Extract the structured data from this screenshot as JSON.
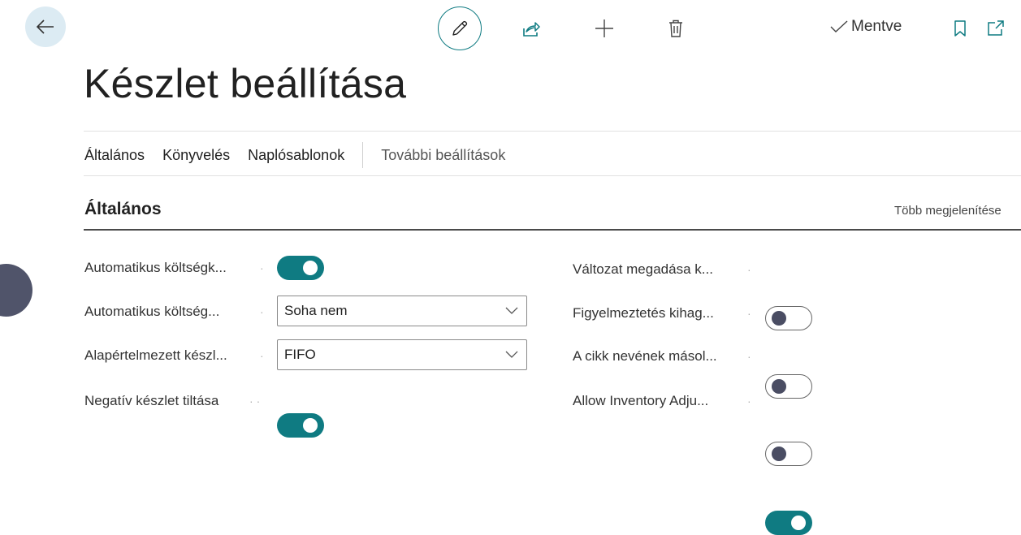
{
  "header": {
    "saved_label": "Mentve"
  },
  "page": {
    "title": "Készlet beállítása"
  },
  "tabs": [
    {
      "label": "Általános"
    },
    {
      "label": "Könyvelés"
    },
    {
      "label": "Naplósablonok"
    }
  ],
  "tabs_more": "További beállítások",
  "section": {
    "title": "Általános",
    "show_more": "Több megjelenítése"
  },
  "left_fields": [
    {
      "label": "Automatikus költségk...",
      "type": "toggle",
      "value": true
    },
    {
      "label": "Automatikus költség...",
      "type": "select",
      "value": "Soha nem"
    },
    {
      "label": "Alapértelmezett készl...",
      "type": "select",
      "value": "FIFO"
    },
    {
      "label": "Negatív készlet tiltása",
      "type": "toggle",
      "value": true
    }
  ],
  "right_fields": [
    {
      "label": "Változat megadása k...",
      "type": "toggle",
      "value": false
    },
    {
      "label": "Figyelmeztetés kihag...",
      "type": "toggle",
      "value": false
    },
    {
      "label": "A cikk nevének másol...",
      "type": "toggle",
      "value": false
    },
    {
      "label": "Allow Inventory Adju...",
      "type": "toggle",
      "value": true
    }
  ],
  "colors": {
    "accent": "#0f7b82",
    "back_bg": "#dcebf3",
    "knob_off": "#4a4d63"
  },
  "icons": [
    "back-arrow-icon",
    "pencil-icon",
    "share-icon",
    "plus-icon",
    "trash-icon",
    "checkmark-icon",
    "bookmark-icon",
    "open-in-new-icon"
  ]
}
